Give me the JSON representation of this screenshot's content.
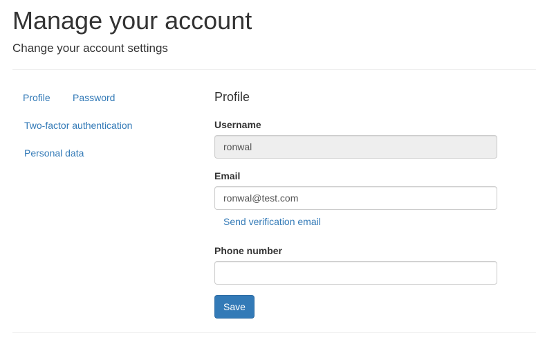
{
  "header": {
    "title": "Manage your account",
    "subtitle": "Change your account settings"
  },
  "nav": {
    "items": [
      {
        "label": "Profile"
      },
      {
        "label": "Password"
      },
      {
        "label": "Two-factor authentication"
      },
      {
        "label": "Personal data"
      }
    ]
  },
  "profile": {
    "section_title": "Profile",
    "username": {
      "label": "Username",
      "value": "ronwal"
    },
    "email": {
      "label": "Email",
      "value": "ronwal@test.com",
      "verify_link": "Send verification email"
    },
    "phone": {
      "label": "Phone number",
      "value": ""
    },
    "save_label": "Save"
  },
  "colors": {
    "link": "#337ab7",
    "primary_button": "#337ab7",
    "disabled_field": "#eeeeee"
  }
}
